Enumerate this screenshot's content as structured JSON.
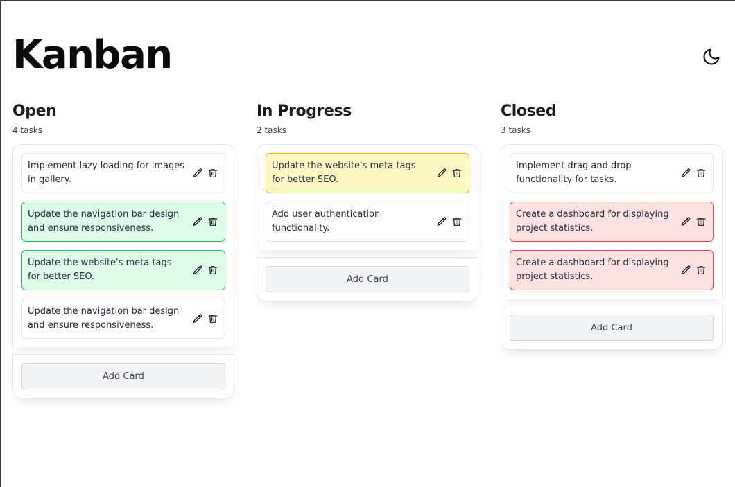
{
  "app": {
    "title": "Kanban",
    "theme_toggle_icon": "moon-icon"
  },
  "colors": {
    "green_bg": "#dcfce7",
    "green_border": "#22c55e",
    "yellow_bg": "#fef9c3",
    "yellow_border": "#eab308",
    "red_bg": "#fee2e2",
    "red_border": "#ef4444"
  },
  "columns": [
    {
      "title": "Open",
      "count": "4 tasks",
      "add_label": "Add Card",
      "cards": [
        {
          "text": "Implement lazy loading for images in gallery.",
          "color": "none"
        },
        {
          "text": "Update the navigation bar design and ensure responsiveness.",
          "color": "green"
        },
        {
          "text": "Update the website's meta tags for better SEO.",
          "color": "green"
        },
        {
          "text": "Update the navigation bar design and ensure responsiveness.",
          "color": "none"
        }
      ]
    },
    {
      "title": "In Progress",
      "count": "2 tasks",
      "add_label": "Add Card",
      "cards": [
        {
          "text": "Update the website's meta tags for better SEO.",
          "color": "yellow"
        },
        {
          "text": "Add user authentication functionality.",
          "color": "none"
        }
      ]
    },
    {
      "title": "Closed",
      "count": "3 tasks",
      "add_label": "Add Card",
      "cards": [
        {
          "text": "Implement drag and drop functionality for tasks.",
          "color": "none"
        },
        {
          "text": "Create a dashboard for displaying project statistics.",
          "color": "red"
        },
        {
          "text": "Create a dashboard for displaying project statistics.",
          "color": "red"
        }
      ]
    }
  ],
  "card_icons": [
    "pencil-icon",
    "trash-icon"
  ]
}
